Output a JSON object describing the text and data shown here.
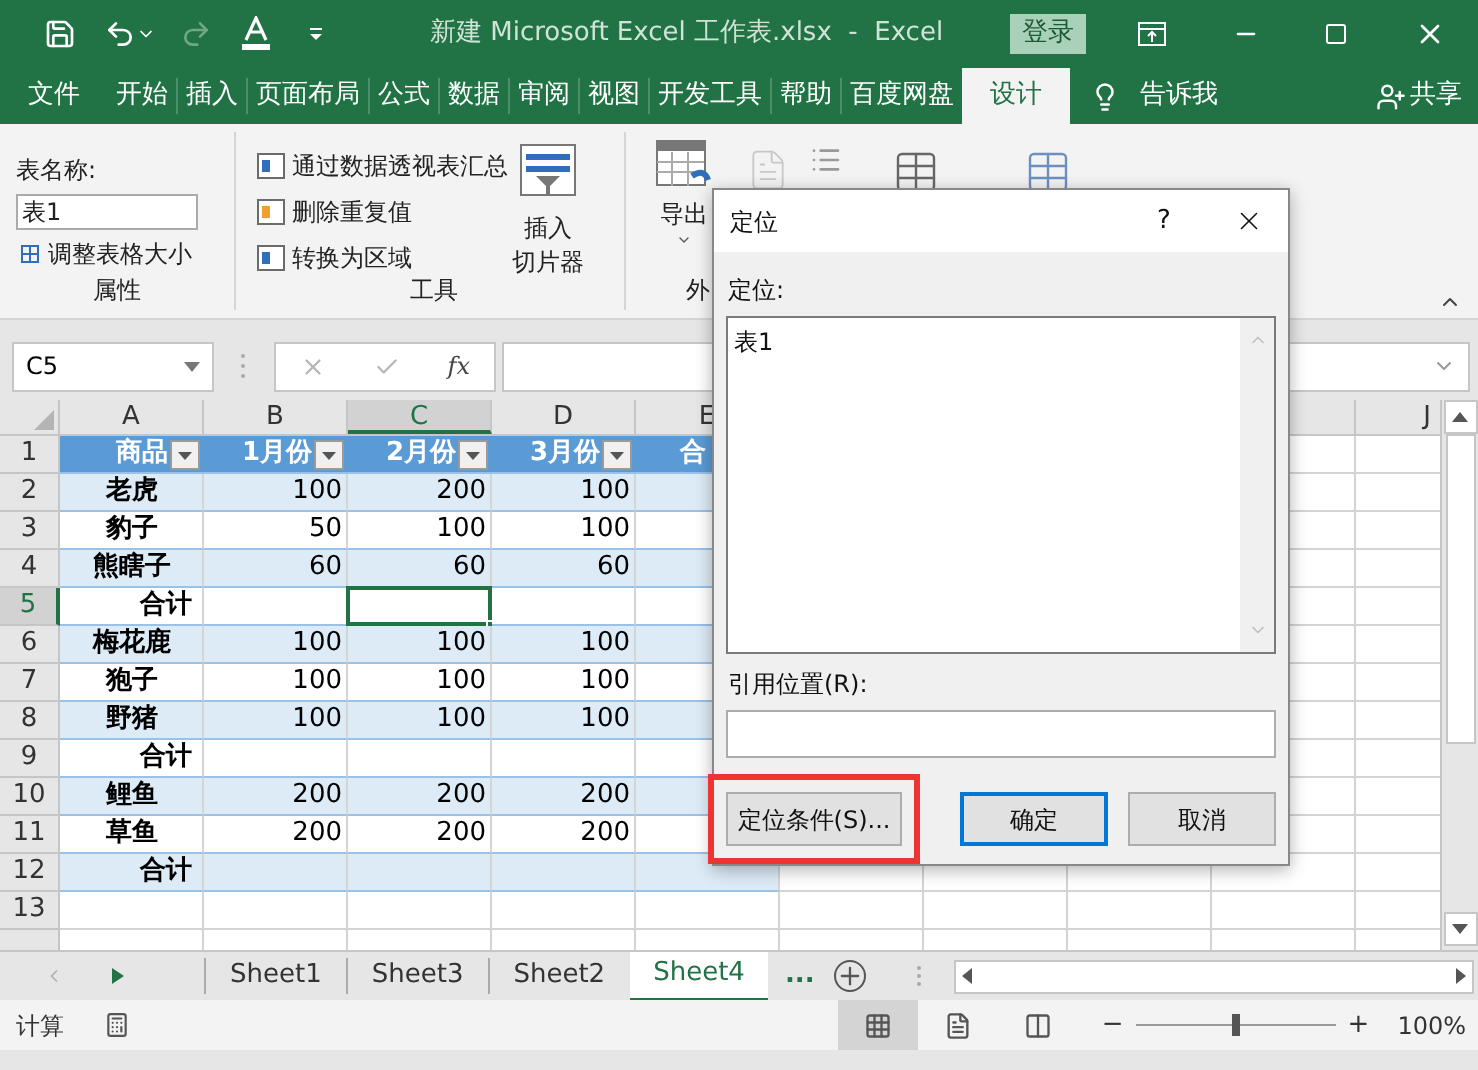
{
  "window": {
    "title": "新建 Microsoft Excel 工作表.xlsx  -  Excel",
    "signin_button": "登录"
  },
  "ribbon_tabs": [
    {
      "label": "文件",
      "selected": false
    },
    {
      "label": "开始",
      "selected": false
    },
    {
      "label": "插入",
      "selected": false
    },
    {
      "label": "页面布局",
      "selected": false
    },
    {
      "label": "公式",
      "selected": false
    },
    {
      "label": "数据",
      "selected": false
    },
    {
      "label": "审阅",
      "selected": false
    },
    {
      "label": "视图",
      "selected": false
    },
    {
      "label": "开发工具",
      "selected": false
    },
    {
      "label": "帮助",
      "selected": false
    },
    {
      "label": "百度网盘",
      "selected": false
    },
    {
      "label": "设计",
      "selected": true
    }
  ],
  "tell_me": "告诉我",
  "share": "共享",
  "ribbon": {
    "properties": {
      "table_name_label": "表名称:",
      "table_name_value": "表1",
      "resize": "调整表格大小",
      "label": "属性"
    },
    "tools": {
      "commands": [
        "通过数据透视表汇总",
        "删除重复值",
        "转换为区域"
      ],
      "slicer": [
        "插入",
        "切片器"
      ],
      "label": "工具"
    },
    "external": {
      "export": "导出",
      "label": "外"
    }
  },
  "formula_bar": {
    "name_box": "C5",
    "function_symbol": "fx"
  },
  "sheet": {
    "columns": [
      {
        "label": "A",
        "selected": false
      },
      {
        "label": "B",
        "selected": false
      },
      {
        "label": "C",
        "selected": true
      },
      {
        "label": "D",
        "selected": false
      },
      {
        "label": "E",
        "selected": false
      },
      {
        "label": "J",
        "selected": false
      }
    ],
    "rows": [
      {
        "number": "1",
        "kind": "header",
        "selected": false,
        "cells": [
          {
            "text": "商品",
            "filter": true
          },
          {
            "text": "1月份",
            "filter": true
          },
          {
            "text": "2月份",
            "filter": true
          },
          {
            "text": "3月份",
            "filter": true
          },
          {
            "text": "合",
            "filter": false
          }
        ]
      },
      {
        "number": "2",
        "kind": "item",
        "banded": true,
        "selected": false,
        "cells": [
          "老虎",
          "100",
          "200",
          "100"
        ]
      },
      {
        "number": "3",
        "kind": "item",
        "banded": false,
        "selected": false,
        "cells": [
          "豹子",
          "50",
          "100",
          "100"
        ]
      },
      {
        "number": "4",
        "kind": "item",
        "banded": true,
        "selected": false,
        "cells": [
          "熊瞎子",
          "60",
          "60",
          "60"
        ]
      },
      {
        "number": "5",
        "kind": "total",
        "banded": false,
        "selected": true,
        "cells": [
          "合计"
        ]
      },
      {
        "number": "6",
        "kind": "item",
        "banded": true,
        "selected": false,
        "cells": [
          "梅花鹿",
          "100",
          "100",
          "100"
        ]
      },
      {
        "number": "7",
        "kind": "item",
        "banded": false,
        "selected": false,
        "cells": [
          "狍子",
          "100",
          "100",
          "100"
        ]
      },
      {
        "number": "8",
        "kind": "item",
        "banded": true,
        "selected": false,
        "cells": [
          "野猪",
          "100",
          "100",
          "100"
        ]
      },
      {
        "number": "9",
        "kind": "total",
        "banded": false,
        "selected": false,
        "cells": [
          "合计"
        ]
      },
      {
        "number": "10",
        "kind": "item",
        "banded": true,
        "selected": false,
        "cells": [
          "鲤鱼",
          "200",
          "200",
          "200"
        ]
      },
      {
        "number": "11",
        "kind": "item",
        "banded": false,
        "selected": false,
        "cells": [
          "草鱼",
          "200",
          "200",
          "200"
        ]
      },
      {
        "number": "12",
        "kind": "total",
        "banded": true,
        "selected": false,
        "cells": [
          "合计"
        ]
      },
      {
        "number": "13",
        "kind": "blank",
        "banded": false,
        "selected": false
      },
      {
        "kind": "blank",
        "banded": false,
        "selected": false
      }
    ]
  },
  "sheet_tabs": [
    {
      "label": "Sheet1",
      "selected": false
    },
    {
      "label": "Sheet3",
      "selected": false
    },
    {
      "label": "Sheet2",
      "selected": false
    },
    {
      "label": "Sheet4",
      "selected": true
    }
  ],
  "more_sheets": "...",
  "status_bar": {
    "mode": "计算",
    "views": [
      {
        "kind": "normal",
        "selected": true
      },
      {
        "kind": "layout",
        "selected": false
      },
      {
        "kind": "pagebreak",
        "selected": false
      }
    ],
    "zoom_out": "−",
    "zoom_in": "+",
    "zoom": {
      "level": 0.5
    },
    "zoom_text": "100%"
  },
  "dialog": {
    "title": "定位",
    "help": "?",
    "list_label": "定位:",
    "list_items": [
      {
        "label": "表1",
        "selected": false
      }
    ],
    "reference_label": "引用位置(R):",
    "buttons": [
      {
        "label": "定位条件(S)...",
        "kind": "normal",
        "highlighted": true
      },
      {
        "label": "确定",
        "kind": "default",
        "highlighted": false
      },
      {
        "label": "取消",
        "kind": "normal",
        "highlighted": false
      }
    ]
  }
}
